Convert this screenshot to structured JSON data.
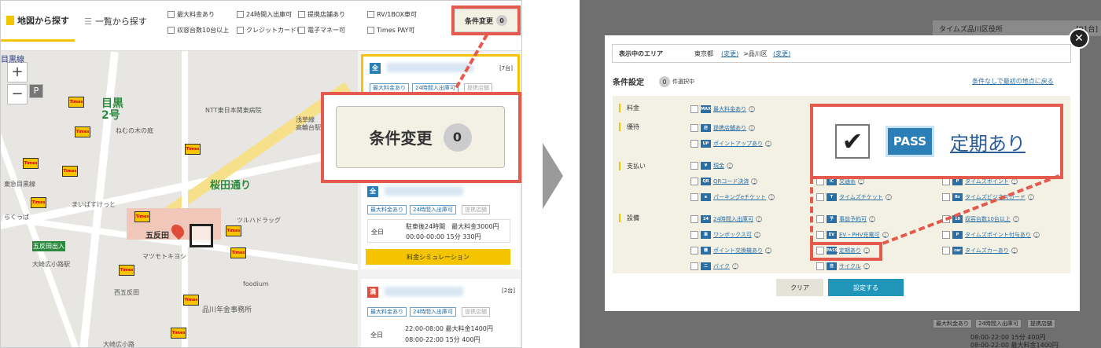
{
  "left": {
    "tabs": {
      "map": "地図から探す",
      "list": "一覧から探す"
    },
    "filters": [
      "最大料金あり",
      "24時間入出庫可",
      "提携店舗あり",
      "RV/1BOX車可",
      "収容台数10台以上",
      "クレジットカード可",
      "電子マネー可",
      "Times PAY可"
    ],
    "cond_button": {
      "label": "条件変更",
      "count": "0"
    },
    "zoom": {
      "plus": "+",
      "minus": "−",
      "parking": "P"
    },
    "map_labels": [
      "目黒線",
      "NTT東日本関東病院",
      "ねむの木の庭",
      "浅草線",
      "高輪台駅",
      "東急目黒線",
      "桜田通り",
      "五反田",
      "五反田出入",
      "大崎広小路駅",
      "品川年金事務所",
      "foodium",
      "西五反田",
      "ツルハドラッグ",
      "大崎広小路",
      "まいばすけっと",
      "らくっぱ",
      "マツモトキヨシ"
    ],
    "road_number": "目黒2号",
    "marker_text": "Times",
    "cards": [
      {
        "pin": "全",
        "count": "[7台]",
        "tags": [
          "最大料金あり",
          "24時間入出庫可",
          "提携店舗"
        ]
      },
      {
        "pin": "全",
        "tags": [
          "最大料金あり",
          "24時間入出庫可",
          "提携店舗"
        ],
        "row_label": "全日",
        "price1": "駐車後24時間　最大料金3000円",
        "price2": "00:00-00:00 15分 330円",
        "sim_button": "料金シミュレーション"
      },
      {
        "pin": "満",
        "count": "[2台]",
        "tags": [
          "最大料金あり",
          "24時間入出庫可",
          "提携店舗"
        ],
        "row_label": "全日",
        "price1": "22:00-08:00 最大料金1400円",
        "price2": "08:00-22:00 15分 400円"
      }
    ],
    "zoom_callout": {
      "label": "条件変更",
      "count": "0"
    }
  },
  "right": {
    "close": "✕",
    "area": {
      "label": "表示中のエリア",
      "pref": "東京都",
      "change1": "(変更)",
      "city": ">品川区",
      "change2": "(変更)"
    },
    "cond_title": "条件設定",
    "selected_count": "0",
    "selected_suffix": "件選択中",
    "back_link": "条件なしで最初の地点に戻る",
    "categories": [
      "料金",
      "優待",
      "支払い",
      "設備"
    ],
    "options": {
      "fee": [
        "最大料金あり"
      ],
      "benefit": [
        "提携店舗あり",
        "ポイントアップあり"
      ],
      "payment_col1": [
        "現金",
        "QRコード決済",
        "パーキングeチケット"
      ],
      "payment_col2": [
        "交通系",
        "タイムズチケット"
      ],
      "payment_col3": [
        "タイムズポイント",
        "タイムズビジネスカード"
      ],
      "equipment_col1": [
        "24時間入出庫可",
        "ワンボックス可",
        "ポイント交換機あり",
        "バイク"
      ],
      "equipment_col2": [
        "事前予約可",
        "EV・PHV充電可",
        "定期あり",
        "サイクル"
      ],
      "equipment_col3": [
        "収容台数10台以上",
        "タイムズポイント付与あり",
        "タイムズカーあり"
      ]
    },
    "buttons": {
      "clear": "クリア",
      "set": "設定する"
    },
    "callout": {
      "check": "✔",
      "pass": "PASS",
      "label": "定期あり"
    },
    "bg_header": "タイムズ品川区役所",
    "bg_count": "[91台]",
    "bg_tags": [
      "最大料金あり",
      "24時間入出庫可",
      "提携店舗"
    ],
    "bg_price1": "08:00-22:00 15分 400円",
    "bg_price2": "08:00-22:00 最大料金1400円"
  },
  "colors": {
    "accent": "#f4c400",
    "highlight": "#e45a4c",
    "link": "#2b6ea3",
    "button": "#2196b8"
  },
  "icons": [
    "map-icon",
    "list-icon",
    "close-icon",
    "check-icon",
    "pass-icon",
    "help-icon"
  ]
}
